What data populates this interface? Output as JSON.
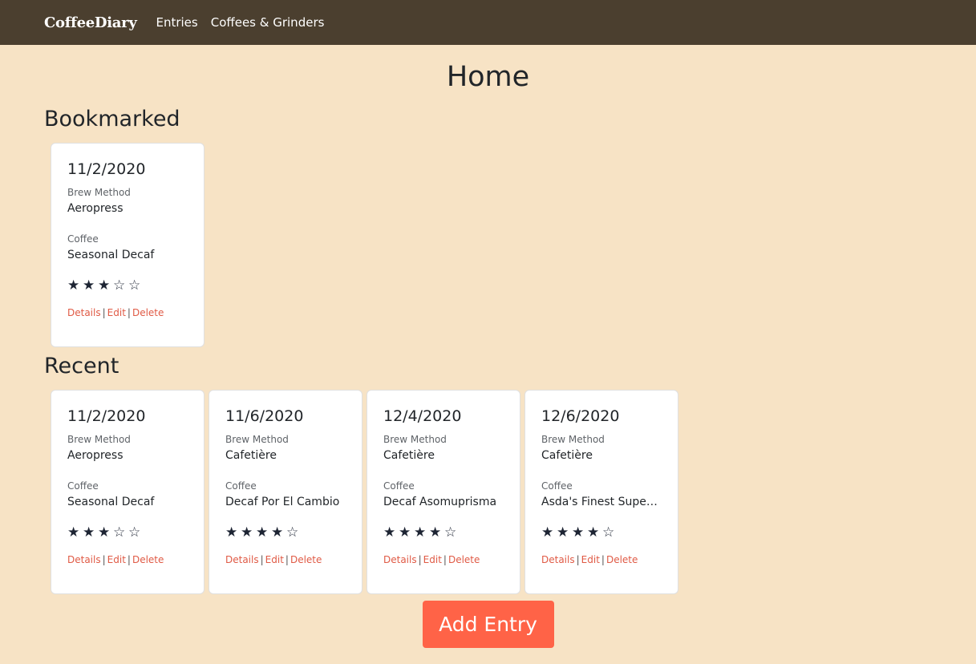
{
  "nav": {
    "brand": "CoffeeDiary",
    "links": [
      "Entries",
      "Coffees & Grinders"
    ]
  },
  "page": {
    "title": "Home"
  },
  "bookmarked": {
    "title": "Bookmarked",
    "cards": [
      {
        "date": "11/2/2020",
        "brew_label": "Brew Method",
        "brew": "Aeropress",
        "coffee_label": "Coffee",
        "coffee": "Seasonal Decaf",
        "rating": 3,
        "actions": [
          "Details",
          "Edit",
          "Delete"
        ]
      }
    ]
  },
  "recent": {
    "title": "Recent",
    "cards": [
      {
        "date": "11/2/2020",
        "brew_label": "Brew Method",
        "brew": "Aeropress",
        "coffee_label": "Coffee",
        "coffee": "Seasonal Decaf",
        "rating": 3,
        "actions": [
          "Details",
          "Edit",
          "Delete"
        ]
      },
      {
        "date": "11/6/2020",
        "brew_label": "Brew Method",
        "brew": "Cafetière",
        "coffee_label": "Coffee",
        "coffee": "Decaf Por El Cambio",
        "rating": 4,
        "actions": [
          "Details",
          "Edit",
          "Delete"
        ]
      },
      {
        "date": "12/4/2020",
        "brew_label": "Brew Method",
        "brew": "Cafetière",
        "coffee_label": "Coffee",
        "coffee": "Decaf Asomuprisma",
        "rating": 4,
        "actions": [
          "Details",
          "Edit",
          "Delete"
        ]
      },
      {
        "date": "12/6/2020",
        "brew_label": "Brew Method",
        "brew": "Cafetière",
        "coffee_label": "Coffee",
        "coffee": "Asda's Finest Super Decaf",
        "rating": 4,
        "actions": [
          "Details",
          "Edit",
          "Delete"
        ]
      }
    ]
  },
  "rating_max": 5,
  "add_button": {
    "label": "Add Entry"
  },
  "colors": {
    "background": "#f7e3c5",
    "navbar": "#4b3f2f",
    "accent": "#ff6347",
    "link": "#e05a45"
  }
}
